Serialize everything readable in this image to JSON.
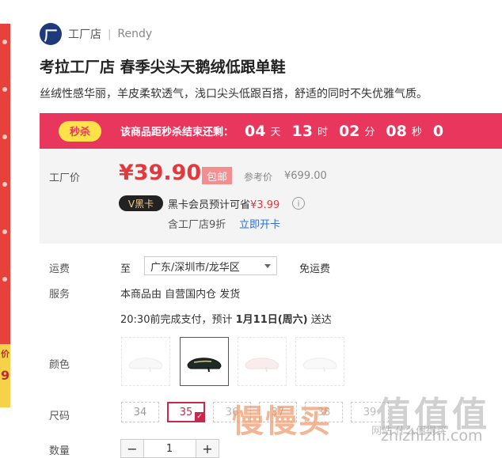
{
  "store": {
    "logo_char": "厂",
    "name": "工厂店",
    "separator": "|",
    "brand": "Rendy"
  },
  "product": {
    "title": "考拉工厂店 春季尖头天鹅绒低跟单鞋",
    "subtitle": "丝绒性感华丽，羊皮柔软透气，浅口尖头低跟百搭，舒适的同时不失优雅气质。"
  },
  "flash_sale": {
    "badge": "秒杀",
    "text": "该商品距秒杀结束还剩：",
    "countdown": [
      {
        "value": "04",
        "unit": "天"
      },
      {
        "value": "13",
        "unit": "时"
      },
      {
        "value": "02",
        "unit": "分"
      },
      {
        "value": "08",
        "unit": "秒"
      },
      {
        "value": "0",
        "unit": ""
      }
    ],
    "color": "#e8365d"
  },
  "price": {
    "label": "工厂价",
    "value": "¥39.90",
    "shipping_tag": "包邮",
    "ref_label": "参考价",
    "ref_value": "¥699.00",
    "black_card_badge": "V黑卡",
    "member_text": "黑卡会员预计可省",
    "member_saving": "¥3.99",
    "info_icon": "i",
    "discount_text": "含工厂店9折",
    "open_card_link": "立即开卡",
    "accent_color": "#e4393c"
  },
  "shipping": {
    "label": "运费",
    "to": "至",
    "region": "广东/深圳市/龙华区",
    "fee": "免运费"
  },
  "service": {
    "label": "服务",
    "text": "本商品由 自营国内仓 发货",
    "delivery_prefix": "20:30前完成支付，预计 ",
    "delivery_date": "1月11日(周六)",
    "delivery_suffix": " 送达"
  },
  "colors": {
    "label": "颜色",
    "options": [
      {
        "name": "white-shoe",
        "selected": false
      },
      {
        "name": "black-shoe",
        "selected": true
      },
      {
        "name": "pink-shoe",
        "selected": false
      },
      {
        "name": "white-shoe-2",
        "selected": false
      }
    ]
  },
  "sizes": {
    "label": "尺码",
    "options": [
      "34",
      "35",
      "36",
      "37",
      "38",
      "39"
    ],
    "selected": "35"
  },
  "quantity": {
    "label": "数量",
    "minus": "−",
    "value": "1",
    "plus": "+"
  },
  "left_banner": {
    "text_1": "价",
    "text_2": "9"
  },
  "watermark": {
    "main": "慢慢买",
    "side": "值值值",
    "sub": "网站 什么值得买",
    "domain": "zhizhizhi.com"
  }
}
